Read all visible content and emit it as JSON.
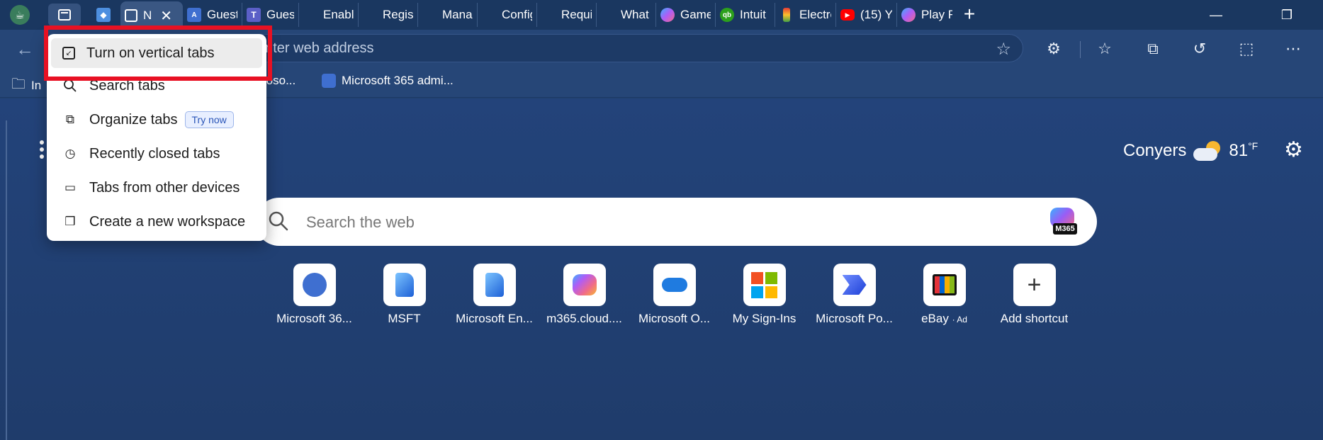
{
  "tabstrip": {
    "tabs": [
      {
        "label": "",
        "favicon": "azure-ai-icon"
      },
      {
        "label": "N",
        "favicon": "tab-actions-icon",
        "active": true
      },
      {
        "label": "Guest",
        "favicon": "azure-ai-icon"
      },
      {
        "label": "Guest",
        "favicon": "teams-icon"
      },
      {
        "label": "Enable",
        "favicon": "microsoft-icon"
      },
      {
        "label": "Regist",
        "favicon": "microsoft-icon"
      },
      {
        "label": "Manag",
        "favicon": "microsoft-icon"
      },
      {
        "label": "Config",
        "favicon": "microsoft-icon"
      },
      {
        "label": "Requir",
        "favicon": "microsoft-icon"
      },
      {
        "label": "What",
        "favicon": "microsoft-icon"
      },
      {
        "label": "Game",
        "favicon": "copilot-icon"
      },
      {
        "label": "Intuit",
        "favicon": "quickbooks-icon"
      },
      {
        "label": "Electro",
        "favicon": "battery-icon"
      },
      {
        "label": "(15) Yo",
        "favicon": "youtube-icon"
      },
      {
        "label": "Play F",
        "favicon": "copilot-icon"
      }
    ]
  },
  "address_bar": {
    "placeholder": "enter web address"
  },
  "favorites_bar": {
    "items": [
      {
        "label": "In",
        "icon": "folder-icon"
      },
      {
        "label": "roso...",
        "icon": "none"
      },
      {
        "label": "Microsoft 365 admi...",
        "icon": "azure-ai-icon"
      }
    ]
  },
  "menu": {
    "items": [
      {
        "label": "Turn on vertical tabs",
        "icon": "vertical-tabs-icon",
        "highlighted": true
      },
      {
        "label": "Search tabs",
        "icon": "search-icon"
      },
      {
        "label": "Organize tabs",
        "icon": "organize-tabs-icon",
        "badge": "Try now"
      },
      {
        "label": "Recently closed tabs",
        "icon": "history-icon"
      },
      {
        "label": "Tabs from other devices",
        "icon": "devices-icon"
      },
      {
        "label": "Create a new workspace",
        "icon": "workspace-icon"
      }
    ]
  },
  "weather": {
    "city": "Conyers",
    "temp": "81",
    "unit": "°F"
  },
  "search": {
    "placeholder": "Search the web",
    "m365_tag": "M365"
  },
  "shortcuts": [
    {
      "label": "Microsoft 36...",
      "icon": "azure-ai-icon"
    },
    {
      "label": "MSFT",
      "icon": "document-icon"
    },
    {
      "label": "Microsoft En...",
      "icon": "document-icon"
    },
    {
      "label": "m365.cloud....",
      "icon": "copilot-icon"
    },
    {
      "label": "Microsoft O...",
      "icon": "onedrive-icon"
    },
    {
      "label": "My Sign-Ins",
      "icon": "microsoft-icon"
    },
    {
      "label": "Microsoft Po...",
      "icon": "power-automate-icon"
    },
    {
      "label": "eBay",
      "icon": "shopping-bag-icon",
      "ad": "· Ad"
    },
    {
      "label": "Add shortcut",
      "icon": "plus-icon"
    }
  ],
  "colors": {
    "accent_red": "#e81123",
    "background": "#21406e",
    "badge_blue": "#2a55b8"
  }
}
